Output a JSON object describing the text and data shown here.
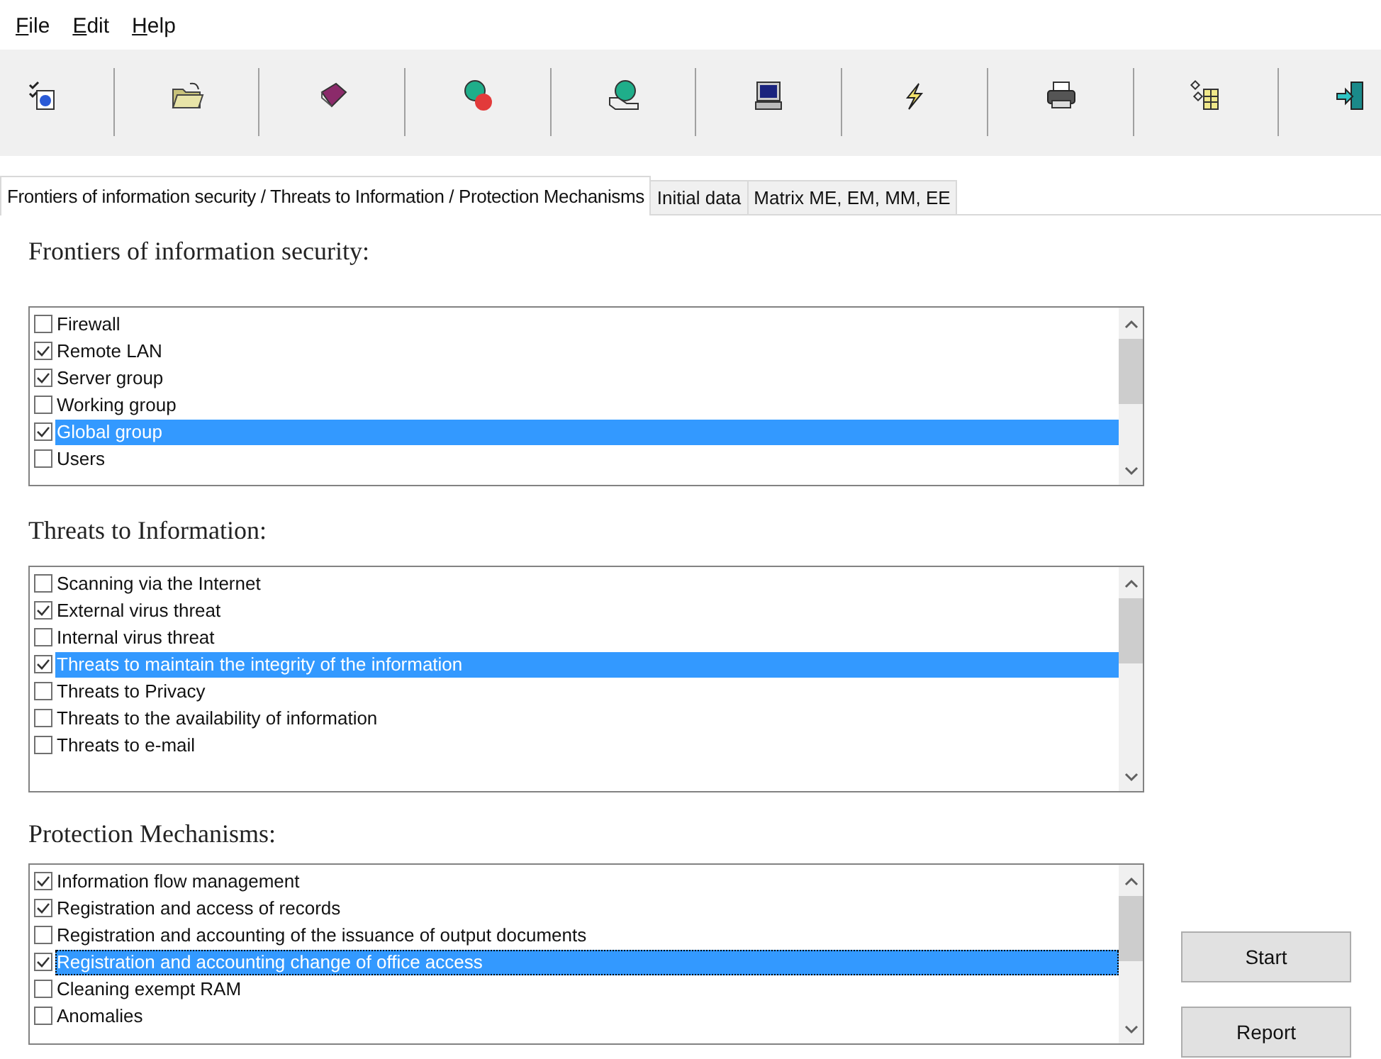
{
  "menu": [
    "File",
    "Edit",
    "Help"
  ],
  "tabs": [
    {
      "label": "Frontiers of information security / Threats to Information / Protection Mechanisms",
      "selected": true
    },
    {
      "label": "Initial data",
      "selected": false
    },
    {
      "label": "Matrix ME, EM, MM, EE",
      "selected": false
    }
  ],
  "sections": [
    {
      "heading": "Frontiers of information security:",
      "focused": false,
      "items": [
        {
          "label": "Firewall",
          "checked": false,
          "selected": false
        },
        {
          "label": "Remote LAN",
          "checked": true,
          "selected": false
        },
        {
          "label": "Server group",
          "checked": true,
          "selected": false
        },
        {
          "label": "Working group",
          "checked": false,
          "selected": false
        },
        {
          "label": "Global group",
          "checked": true,
          "selected": true
        },
        {
          "label": "Users",
          "checked": false,
          "selected": false
        }
      ]
    },
    {
      "heading": "Threats to Information:",
      "focused": false,
      "items": [
        {
          "label": "Scanning via the Internet",
          "checked": false,
          "selected": false
        },
        {
          "label": "External virus threat",
          "checked": true,
          "selected": false
        },
        {
          "label": "Internal virus threat",
          "checked": false,
          "selected": false
        },
        {
          "label": "Threats to maintain the integrity of the information",
          "checked": true,
          "selected": true
        },
        {
          "label": "Threats to Privacy",
          "checked": false,
          "selected": false
        },
        {
          "label": "Threats to the availability of information",
          "checked": false,
          "selected": false
        },
        {
          "label": "Threats to e-mail",
          "checked": false,
          "selected": false
        }
      ]
    },
    {
      "heading": "Protection Mechanisms:",
      "focused": true,
      "items": [
        {
          "label": "Information flow management",
          "checked": true,
          "selected": false
        },
        {
          "label": "Registration and access of records",
          "checked": true,
          "selected": false
        },
        {
          "label": "Registration and accounting of the issuance of output documents",
          "checked": false,
          "selected": false
        },
        {
          "label": "Registration and accounting change of office access",
          "checked": true,
          "selected": true
        },
        {
          "label": "Cleaning exempt RAM",
          "checked": false,
          "selected": false
        },
        {
          "label": "Anomalies",
          "checked": false,
          "selected": false
        }
      ]
    }
  ],
  "buttons": [
    "Start",
    "Report"
  ]
}
